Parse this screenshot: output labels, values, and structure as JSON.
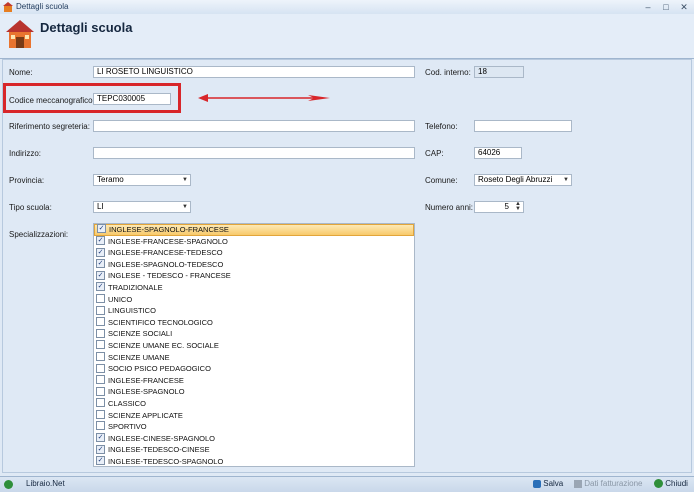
{
  "window": {
    "title": "Dettagli scuola",
    "min": "–",
    "max": "□",
    "close": "✕"
  },
  "header": {
    "title": "Dettagli scuola",
    "icon": "school-house-icon"
  },
  "form": {
    "nome": {
      "label": "Nome:",
      "value": "LI ROSETO LINGUISTICO"
    },
    "cod_interno": {
      "label": "Cod. interno:",
      "value": "18"
    },
    "codice_mecc": {
      "label": "Codice meccanografico:",
      "value": "TEPC030005"
    },
    "rif_segreteria": {
      "label": "Riferimento segreteria:",
      "value": ""
    },
    "telefono": {
      "label": "Telefono:",
      "value": ""
    },
    "indirizzo": {
      "label": "Indirizzo:",
      "value": ""
    },
    "cap": {
      "label": "CAP:",
      "value": "64026"
    },
    "provincia": {
      "label": "Provincia:",
      "value": "Teramo"
    },
    "comune": {
      "label": "Comune:",
      "value": "Roseto Degli Abruzzi"
    },
    "tipo_scuola": {
      "label": "Tipo scuola:",
      "value": "LI"
    },
    "numero_anni": {
      "label": "Numero anni:",
      "value": "5"
    },
    "specializzazioni_label": "Specializzazioni:"
  },
  "specializzazioni": [
    {
      "label": "INGLESE-SPAGNOLO-FRANCESE",
      "checked": true,
      "selected": true
    },
    {
      "label": "INGLESE-FRANCESE-SPAGNOLO",
      "checked": true
    },
    {
      "label": "INGLESE-FRANCESE-TEDESCO",
      "checked": true
    },
    {
      "label": "INGLESE-SPAGNOLO-TEDESCO",
      "checked": true
    },
    {
      "label": "INGLESE - TEDESCO - FRANCESE",
      "checked": true
    },
    {
      "label": "TRADIZIONALE",
      "checked": true
    },
    {
      "label": "UNICO",
      "checked": false
    },
    {
      "label": "LINGUISTICO",
      "checked": false
    },
    {
      "label": "SCIENTIFICO TECNOLOGICO",
      "checked": false
    },
    {
      "label": "SCIENZE SOCIALI",
      "checked": false
    },
    {
      "label": "SCIENZE UMANE EC. SOCIALE",
      "checked": false
    },
    {
      "label": "SCIENZE UMANE",
      "checked": false
    },
    {
      "label": "SOCIO PSICO PEDAGOGICO",
      "checked": false
    },
    {
      "label": "INGLESE-FRANCESE",
      "checked": false
    },
    {
      "label": "INGLESE-SPAGNOLO",
      "checked": false
    },
    {
      "label": "CLASSICO",
      "checked": false
    },
    {
      "label": "SCIENZE APPLICATE",
      "checked": false
    },
    {
      "label": "SPORTIVO",
      "checked": false
    },
    {
      "label": "INGLESE-CINESE-SPAGNOLO",
      "checked": true
    },
    {
      "label": "INGLESE-TEDESCO-CINESE",
      "checked": true
    },
    {
      "label": "INGLESE-TEDESCO-SPAGNOLO",
      "checked": true
    }
  ],
  "status": {
    "app": "Libraio.Net",
    "salva": "Salva",
    "dati_fatturazione": "Dati fatturazione",
    "chiudi": "Chiudi"
  },
  "colors": {
    "highlight": "#d8262a",
    "arrow": "#d8262a"
  }
}
